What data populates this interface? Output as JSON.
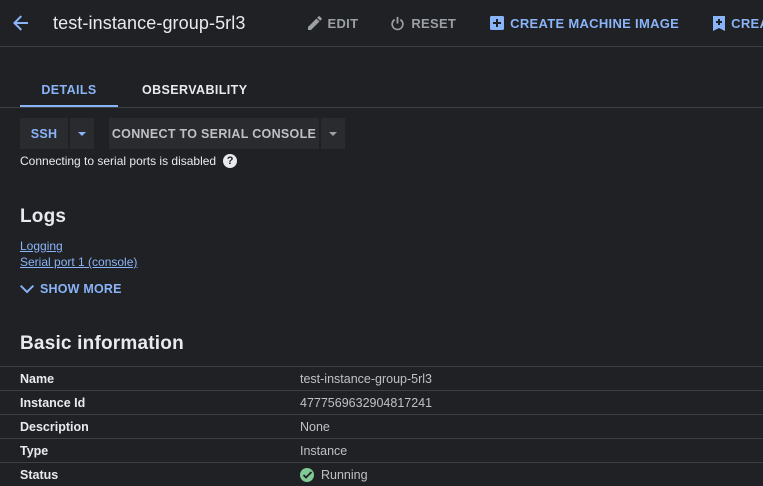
{
  "header": {
    "title": "test-instance-group-5rl3",
    "edit_label": "EDIT",
    "reset_label": "RESET",
    "create_image_label": "CREATE MACHINE IMAGE",
    "create_snapshot_label": "CREATE S"
  },
  "tabs": [
    {
      "label": "DETAILS",
      "active": true
    },
    {
      "label": "OBSERVABILITY",
      "active": false
    }
  ],
  "actions": {
    "ssh_label": "SSH",
    "serial_label": "CONNECT TO SERIAL CONSOLE"
  },
  "serial_note": "Connecting to serial ports is disabled",
  "logs": {
    "title": "Logs",
    "links": [
      "Logging",
      "Serial port 1 (console)"
    ],
    "show_more": "SHOW MORE"
  },
  "basic_info": {
    "title": "Basic information",
    "rows": [
      {
        "key": "Name",
        "value": "test-instance-group-5rl3"
      },
      {
        "key": "Instance Id",
        "value": "4777569632904817241"
      },
      {
        "key": "Description",
        "value": "None"
      },
      {
        "key": "Type",
        "value": "Instance"
      },
      {
        "key": "Status",
        "value": "Running"
      }
    ]
  },
  "colors": {
    "background": "#202124",
    "accent": "#8ab4f8",
    "status_running": "#81c995"
  }
}
